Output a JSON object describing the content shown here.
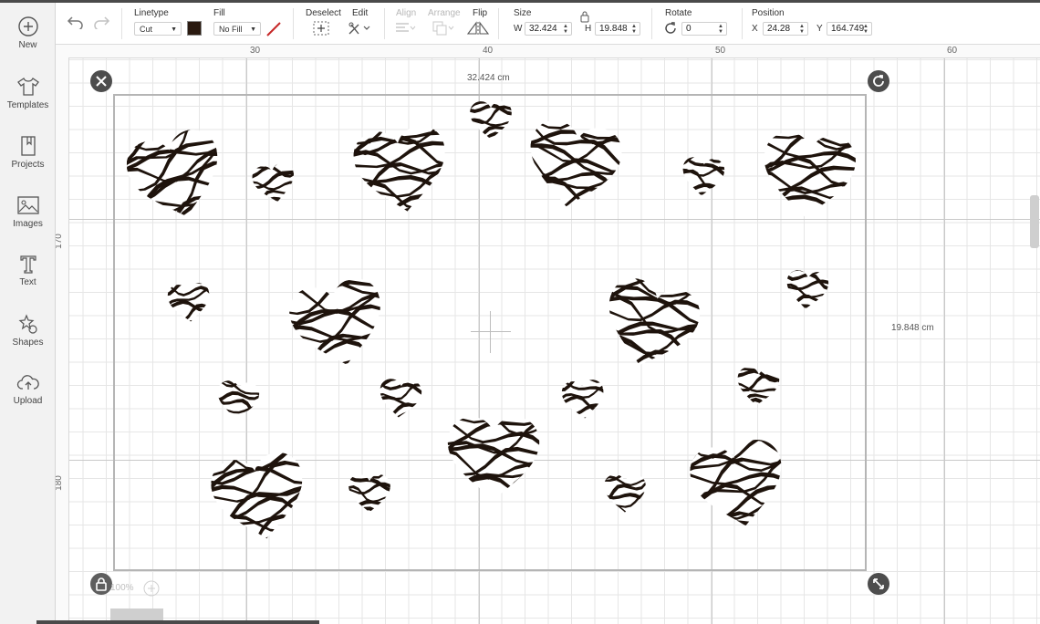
{
  "sidebar": {
    "items": [
      {
        "label": "New",
        "icon": "plus-circle-icon"
      },
      {
        "label": "Templates",
        "icon": "tshirt-icon"
      },
      {
        "label": "Projects",
        "icon": "bookmark-icon"
      },
      {
        "label": "Images",
        "icon": "image-icon"
      },
      {
        "label": "Text",
        "icon": "text-t-icon"
      },
      {
        "label": "Shapes",
        "icon": "shapes-icon"
      },
      {
        "label": "Upload",
        "icon": "cloud-upload-icon"
      }
    ]
  },
  "toolbar": {
    "linetype_label": "Linetype",
    "linetype_value": "Cut",
    "linetype_color": "#2a1a10",
    "fill_label": "Fill",
    "fill_value": "No Fill",
    "deselect_label": "Deselect",
    "edit_label": "Edit",
    "align_label": "Align",
    "arrange_label": "Arrange",
    "flip_label": "Flip",
    "size_label": "Size",
    "w_label": "W",
    "w_value": "32.424",
    "h_label": "H",
    "h_value": "19.848",
    "rotate_label": "Rotate",
    "rotate_value": "0",
    "position_label": "Position",
    "x_label": "X",
    "x_value": "24.28",
    "y_label": "Y",
    "y_value": "164.749"
  },
  "canvas": {
    "ruler_top": [
      "30",
      "40",
      "50",
      "60"
    ],
    "ruler_left": [
      "170",
      "180"
    ],
    "width_dim": "32.424 cm",
    "height_dim": "19.848 cm",
    "zoom": "100%",
    "pattern": "zebra-print-hearts",
    "print_color": "#1e130c"
  }
}
